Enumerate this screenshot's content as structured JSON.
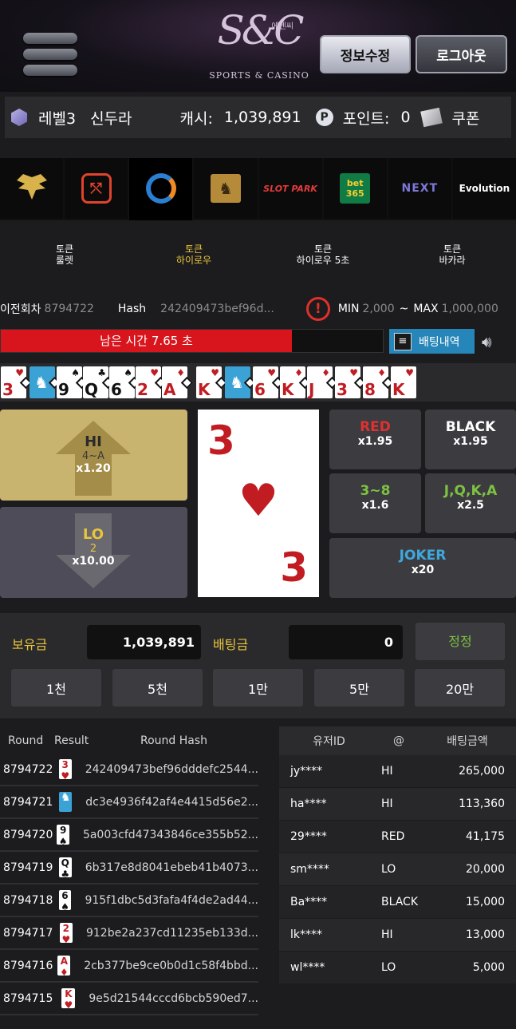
{
  "header": {
    "logo_main": "S&C",
    "logo_sub": "SPORTS & CASINO",
    "logo_kr": "에센씨",
    "edit_label": "정보수정",
    "logout_label": "로그아웃"
  },
  "userbar": {
    "level": "레벨3",
    "name": "신두라",
    "cash_label": "캐시:",
    "cash_value": "1,039,891",
    "point_label": "포인트:",
    "point_value": "0",
    "coupon_label": "쿠폰"
  },
  "providers": [
    "",
    "",
    "",
    "",
    "SLOT PARK",
    "bet 365",
    "NEXT",
    "Evolution"
  ],
  "game_tabs": [
    {
      "line1": "토큰",
      "line2": "룰렛"
    },
    {
      "line1": "토큰",
      "line2": "하이로우"
    },
    {
      "line1": "토큰",
      "line2": "하이로우 5초"
    },
    {
      "line1": "토큰",
      "line2": "바카라"
    }
  ],
  "info": {
    "prev_label": "이전회차",
    "prev_value": "8794722",
    "hash_label": "Hash",
    "hash_value": "242409473bef96d...",
    "min_label": "MIN",
    "min_value": "2,000",
    "tilde": "~",
    "max_label": "MAX",
    "max_value": "1,000,000"
  },
  "timer": {
    "text": "남은 시간 7.65 초",
    "fraction": 0.759
  },
  "history_button": "배팅내역",
  "strip": [
    {
      "rank": "3",
      "suit": "♥",
      "color": "red"
    },
    {
      "rank": "",
      "suit": "",
      "color": "joker"
    },
    {
      "rank": "9",
      "suit": "♠",
      "color": "black"
    },
    {
      "rank": "Q",
      "suit": "♣",
      "color": "black"
    },
    {
      "rank": "6",
      "suit": "♠",
      "color": "black"
    },
    {
      "rank": "2",
      "suit": "♥",
      "color": "red"
    },
    {
      "rank": "A",
      "suit": "♦",
      "color": "red"
    },
    {
      "rank": "K",
      "suit": "♥",
      "color": "red"
    },
    {
      "rank": "",
      "suit": "",
      "color": "joker"
    },
    {
      "rank": "6",
      "suit": "♥",
      "color": "red"
    },
    {
      "rank": "K",
      "suit": "♦",
      "color": "red"
    },
    {
      "rank": "J",
      "suit": "♦",
      "color": "red"
    },
    {
      "rank": "3",
      "suit": "♥",
      "color": "red"
    },
    {
      "rank": "8",
      "suit": "♦",
      "color": "red"
    },
    {
      "rank": "K",
      "suit": "♥",
      "color": "red"
    }
  ],
  "hi": {
    "title": "HI",
    "range": "4~A",
    "odds": "x1.20"
  },
  "lo": {
    "title": "LO",
    "range": "2",
    "odds": "x10.00"
  },
  "current_card": {
    "rank": "3",
    "suit": "♥"
  },
  "options": {
    "red": {
      "label": "RED",
      "odds": "x1.95"
    },
    "black": {
      "label": "BLACK",
      "odds": "x1.95"
    },
    "low": {
      "label": "3~8",
      "odds": "x1.6"
    },
    "face": {
      "label": "J,Q,K,A",
      "odds": "x2.5"
    },
    "joker": {
      "label": "JOKER",
      "odds": "x20"
    }
  },
  "bet": {
    "balance_label": "보유금",
    "balance_value": "1,039,891",
    "bet_label": "배팅금",
    "bet_value": "0",
    "reset_label": "정정",
    "chips": [
      "1천",
      "5천",
      "1만",
      "5만",
      "20만"
    ]
  },
  "round_table": {
    "headers": [
      "Round",
      "Result",
      "Round Hash"
    ],
    "rows": [
      {
        "round": "8794722",
        "rank": "3",
        "suit": "♥",
        "color": "red",
        "hash": "242409473bef96dddefc2544..."
      },
      {
        "round": "8794721",
        "rank": "",
        "suit": "",
        "color": "joker",
        "hash": "dc3e4936f42af4e4415d56e2..."
      },
      {
        "round": "8794720",
        "rank": "9",
        "suit": "♠",
        "color": "black",
        "hash": "5a003cfd47343846ce355b52..."
      },
      {
        "round": "8794719",
        "rank": "Q",
        "suit": "♣",
        "color": "black",
        "hash": "6b317e8d8041ebeb41b4073..."
      },
      {
        "round": "8794718",
        "rank": "6",
        "suit": "♠",
        "color": "black",
        "hash": "915f1dbc5d3fafa4f4de2ad44..."
      },
      {
        "round": "8794717",
        "rank": "2",
        "suit": "♥",
        "color": "red",
        "hash": "912be2a237cd11235eb133d..."
      },
      {
        "round": "8794716",
        "rank": "A",
        "suit": "♦",
        "color": "red",
        "hash": "2cb377be9ce0b0d1c58f4bbd..."
      },
      {
        "round": "8794715",
        "rank": "K",
        "suit": "♥",
        "color": "red",
        "hash": "9e5d21544cccd6bcb590ed7..."
      }
    ]
  },
  "user_table": {
    "headers": [
      "유저ID",
      "@",
      "배팅금액"
    ],
    "rows": [
      {
        "id": "jy****",
        "bet": "HI",
        "amount": "265,000"
      },
      {
        "id": "ha****",
        "bet": "HI",
        "amount": "113,360"
      },
      {
        "id": "29****",
        "bet": "RED",
        "amount": "41,175"
      },
      {
        "id": "sm****",
        "bet": "LO",
        "amount": "20,000"
      },
      {
        "id": "Ba****",
        "bet": "BLACK",
        "amount": "15,000"
      },
      {
        "id": "lk****",
        "bet": "HI",
        "amount": "13,000"
      },
      {
        "id": "wl****",
        "bet": "LO",
        "amount": "5,000"
      }
    ]
  },
  "colors": {
    "accent_gold": "#e9c53c",
    "red": "#d8151d",
    "blue": "#2786b9",
    "green": "#7dc242",
    "cyan": "#3ea8dd"
  }
}
